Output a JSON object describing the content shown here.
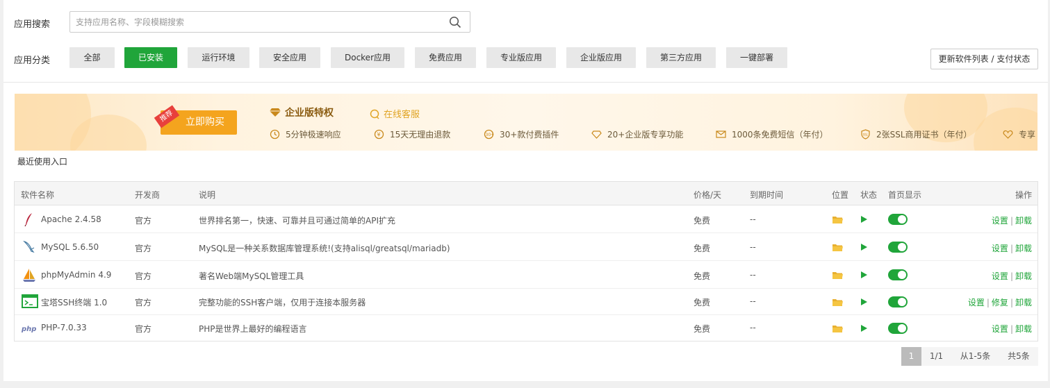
{
  "search": {
    "label": "应用搜索",
    "placeholder": "支持应用名称、字段模糊搜索",
    "value": ""
  },
  "category": {
    "label": "应用分类",
    "items": [
      "全部",
      "已安装",
      "运行环境",
      "安全应用",
      "Docker应用",
      "免费应用",
      "专业版应用",
      "企业版应用",
      "第三方应用",
      "一键部署"
    ],
    "active": "已安装"
  },
  "update_button": "更新软件列表 / 支付状态",
  "banner": {
    "tag": "推荐",
    "buy": "立即购买",
    "title": "企业版特权",
    "online": "在线客服",
    "features": [
      "5分钟极速响应",
      "15天无理由退款",
      "30+款付费插件",
      "20+企业版专享功能",
      "1000条免费短信（年付）",
      "2张SSL商用证书（年付）",
      "专享"
    ]
  },
  "recent_label": "最近使用入口",
  "table": {
    "headers": {
      "name": "软件名称",
      "vendor": "开发商",
      "desc": "说明",
      "price": "价格/天",
      "expire": "到期时间",
      "location": "位置",
      "status": "状态",
      "home": "首页显示",
      "ops": "操作"
    },
    "rows": [
      {
        "name": "Apache 2.4.58",
        "vendor": "官方",
        "desc": "世界排名第一，快速、可靠并且可通过简单的API扩充",
        "price": "免费",
        "expire": "--",
        "ops": [
          "设置",
          "卸载"
        ]
      },
      {
        "name": "MySQL 5.6.50",
        "vendor": "官方",
        "desc": "MySQL是一种关系数据库管理系统!(支持alisql/greatsql/mariadb)",
        "price": "免费",
        "expire": "--",
        "ops": [
          "设置",
          "卸载"
        ]
      },
      {
        "name": "phpMyAdmin 4.9",
        "vendor": "官方",
        "desc": "著名Web端MySQL管理工具",
        "price": "免费",
        "expire": "--",
        "ops": [
          "设置",
          "卸载"
        ]
      },
      {
        "name": "宝塔SSH终端 1.0",
        "vendor": "官方",
        "desc": "完整功能的SSH客户端，仅用于连接本服务器",
        "price": "免费",
        "expire": "--",
        "ops": [
          "设置",
          "修复",
          "卸载"
        ]
      },
      {
        "name": "PHP-7.0.33",
        "vendor": "官方",
        "desc": "PHP是世界上最好的编程语言",
        "price": "免费",
        "expire": "--",
        "ops": [
          "设置",
          "卸载"
        ]
      }
    ]
  },
  "pagination": {
    "current": "1",
    "pages": "1/1",
    "range": "从1-5条",
    "total": "共5条"
  },
  "colors": {
    "accent": "#20a53a",
    "buy": "#f4a41e"
  }
}
